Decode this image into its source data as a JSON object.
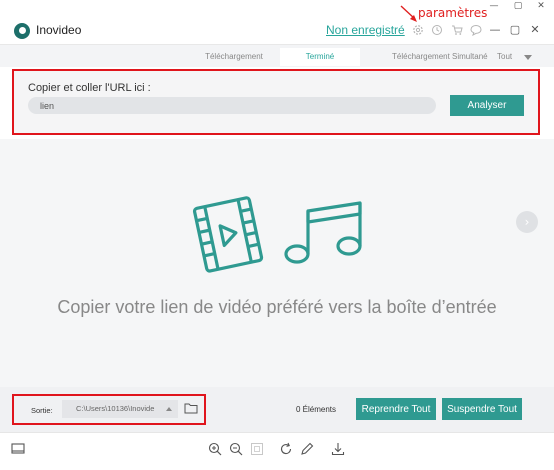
{
  "os": {
    "controls": [
      "—",
      "▢",
      "✕"
    ]
  },
  "annotation": {
    "label": "paramètres"
  },
  "titlebar": {
    "app_name": "Inovideo",
    "unregistered_link": "Non enregistré",
    "icons": [
      "gear-icon",
      "clock-icon",
      "cart-icon",
      "chat-icon"
    ],
    "window_controls": [
      "—",
      "▢",
      "✕"
    ]
  },
  "tabs": {
    "items": [
      {
        "label": "Téléchargement",
        "active": false
      },
      {
        "label": "Terminé",
        "active": true
      }
    ],
    "simultaneous_label": "Téléchargement Simultané",
    "simultaneous_value": "Tout"
  },
  "url_panel": {
    "label": "Copier et coller l'URL ici :",
    "input_value": "lien",
    "analyze_button": "Analyser"
  },
  "main": {
    "empty_message": "Copier votre lien de vidéo préféré vers la boîte d’entrée",
    "accent_color": "#2f9a91"
  },
  "footer": {
    "output_label": "Sortie:",
    "output_path": "C:\\Users\\10136\\Inovide",
    "count": "0 Éléments",
    "resume_button": "Reprendre Tout",
    "suspend_button": "Suspendre Tout"
  }
}
